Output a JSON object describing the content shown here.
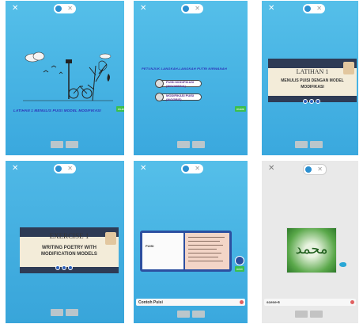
{
  "panels": [
    {
      "id": "scene-1",
      "title": "LATIHAN 1 MENULIS PUISI MODEL MODIFIKASI",
      "button": "mulai"
    },
    {
      "id": "scene-2",
      "title": "PETUNJUK LANGKAH-LANGKAH PUTRI NIRWANAH",
      "options": [
        "PUISI MODIFIKASI (INDONESIA)",
        "MODIFIKASI PUISI (INGGRIS)"
      ],
      "button": "mulai"
    },
    {
      "id": "scene-3",
      "heading": "LATIHAN 1",
      "subtitle_line1": "MENULIS PUISI DENGAN MODEL",
      "subtitle_line2": "MODIFIKASI"
    },
    {
      "id": "scene-4",
      "heading": "EXERCISE 1",
      "subtitle_line1": "WRITING POETRY WITH",
      "subtitle_line2": "MODIFICATION MODELS"
    },
    {
      "id": "scene-5",
      "book_title": "PUISI",
      "caption": "Contoh Puisi",
      "button": "next"
    },
    {
      "id": "scene-6",
      "caption": "scene-6",
      "calligraphy": "محمد"
    }
  ],
  "colors": {
    "sky": "#3aa8de",
    "navy": "#2e3b55",
    "cream": "#f3ecd9",
    "green": "#3cbf4e",
    "purple": "#2c2fb8"
  }
}
